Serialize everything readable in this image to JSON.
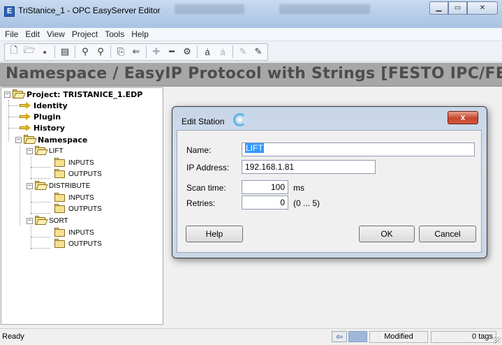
{
  "window": {
    "title": "TriStanice_1 - OPC EasyServer Editor",
    "app_icon": "E",
    "controls": [
      "minimize-icon",
      "maximize-icon",
      "close-icon"
    ]
  },
  "menu": [
    "File",
    "Edit",
    "View",
    "Project",
    "Tools",
    "Help"
  ],
  "toolbar": {
    "buttons": [
      "new-icon",
      "open-icon",
      "save-icon",
      "properties-icon",
      "find-icon",
      "find-replace-icon",
      "import-icon",
      "back-icon",
      "add-icon",
      "remove-icon",
      "settings-icon",
      "rename-icon",
      "rename-disabled-icon",
      "edit-disabled-icon",
      "edit-icon"
    ]
  },
  "header": {
    "title": "Namespace / EasyIP Protocol with Strings [FESTO IPC/FEC]"
  },
  "tree": {
    "project": "Project: TRISTANICE_1.EDP",
    "identity": "Identity",
    "plugin": "Plugin",
    "history": "History",
    "namespace": "Namespace",
    "lift": "LIFT",
    "lift_inputs": "INPUTS",
    "lift_outputs": "OUTPUTS",
    "distribute": "DISTRIBUTE",
    "distribute_inputs": "INPUTS",
    "distribute_outputs": "OUTPUTS",
    "sort": "SORT",
    "sort_inputs": "INPUTS",
    "sort_outputs": "OUTPUTS"
  },
  "dialog": {
    "title": "Edit Station",
    "close": "x",
    "name_label": "Name:",
    "name_value": "LIFT",
    "ip_label": "IP Address:",
    "ip_value": "192.168.1.81",
    "scan_label": "Scan time:",
    "scan_value": "100",
    "scan_unit": "ms",
    "retries_label": "Retries:",
    "retries_value": "0",
    "retries_range": "(0 ... 5)",
    "help": "Help",
    "ok": "OK",
    "cancel": "Cancel"
  },
  "status": {
    "ready": "Ready",
    "modified": "Modified",
    "tags": "0 tags"
  }
}
